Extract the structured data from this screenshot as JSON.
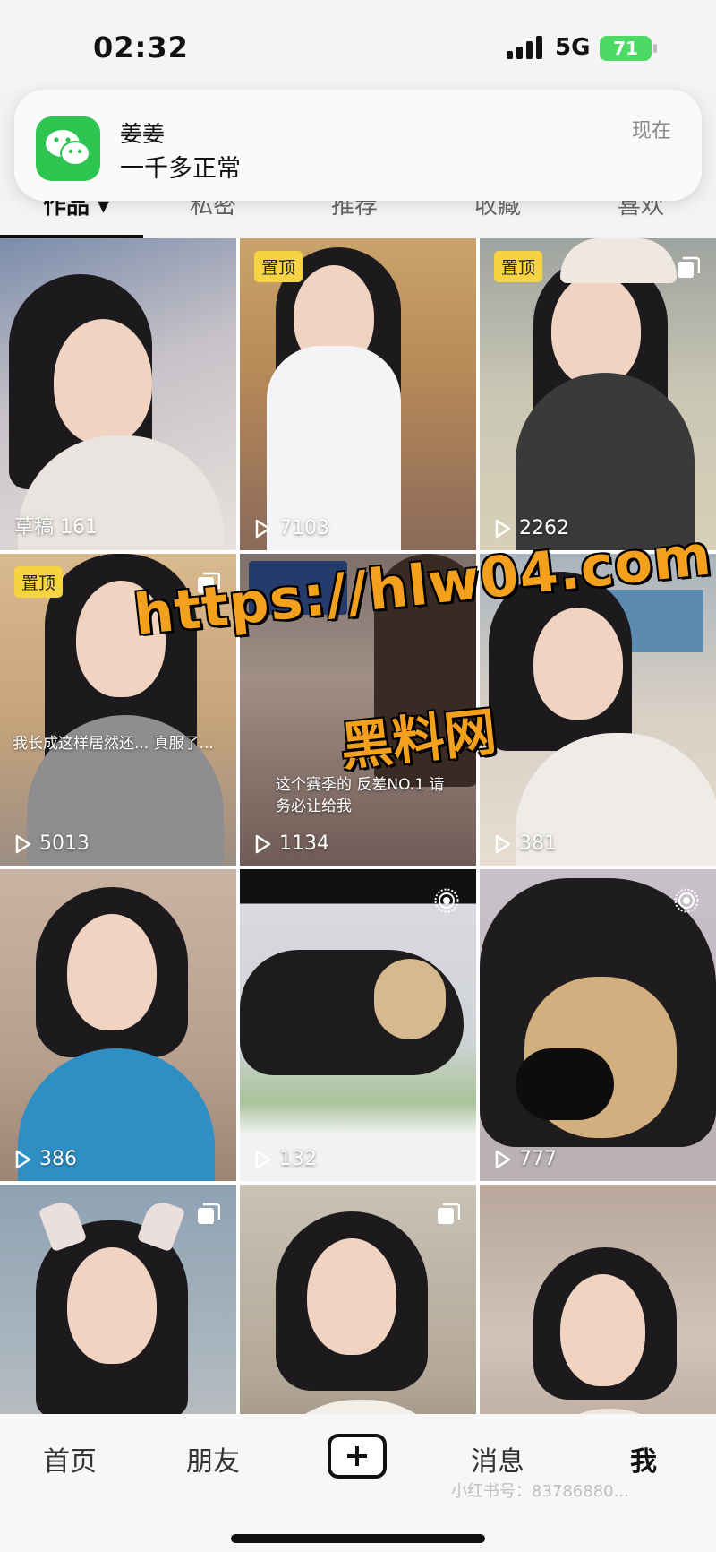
{
  "status_bar": {
    "time": "02:32",
    "network": "5G",
    "battery": "71"
  },
  "notification": {
    "app_icon": "wechat-icon",
    "title": "姜姜",
    "message": "一千多正常",
    "time": "现在"
  },
  "tabs": [
    {
      "label": "作品 ▾",
      "active": true
    },
    {
      "label": "私密",
      "active": false
    },
    {
      "label": "推荐",
      "active": false
    },
    {
      "label": "收藏",
      "active": false
    },
    {
      "label": "喜欢",
      "active": false
    }
  ],
  "grid": {
    "items": [
      {
        "badge": "",
        "corner_icon": "",
        "draft": "草稿 161",
        "views": "",
        "caption": ""
      },
      {
        "badge": "置顶",
        "corner_icon": "",
        "draft": "",
        "views": "7103",
        "caption": ""
      },
      {
        "badge": "置顶",
        "corner_icon": "multi-image-icon",
        "draft": "",
        "views": "2262",
        "caption": ""
      },
      {
        "badge": "置顶",
        "corner_icon": "multi-image-icon",
        "draft": "",
        "views": "5013",
        "caption": "我长成这样居然还... 真服了..."
      },
      {
        "badge": "",
        "corner_icon": "",
        "draft": "",
        "views": "1134",
        "caption": "这个赛季的 反差NO.1 请务必让给我"
      },
      {
        "badge": "",
        "corner_icon": "",
        "draft": "",
        "views": "381",
        "caption": ""
      },
      {
        "badge": "",
        "corner_icon": "",
        "draft": "",
        "views": "386",
        "caption": ""
      },
      {
        "badge": "",
        "corner_icon": "live-photo-icon",
        "draft": "",
        "views": "132",
        "caption": ""
      },
      {
        "badge": "",
        "corner_icon": "live-photo-icon",
        "draft": "",
        "views": "777",
        "caption": ""
      },
      {
        "badge": "",
        "corner_icon": "multi-image-icon",
        "draft": "",
        "views": "",
        "caption": ""
      },
      {
        "badge": "",
        "corner_icon": "multi-image-icon",
        "draft": "",
        "views": "",
        "caption": ""
      },
      {
        "badge": "",
        "corner_icon": "",
        "draft": "",
        "views": "",
        "caption": ""
      }
    ]
  },
  "watermark": {
    "url": "https://hlw04.com",
    "name": "黑料网"
  },
  "bottom_nav": [
    {
      "label": "首页",
      "active": false
    },
    {
      "label": "朋友",
      "active": false
    },
    {
      "label": "+",
      "active": false,
      "icon": "plus-icon"
    },
    {
      "label": "消息",
      "active": false
    },
    {
      "label": "我",
      "active": true
    }
  ],
  "source_watermark": "小红书号：83786880..."
}
